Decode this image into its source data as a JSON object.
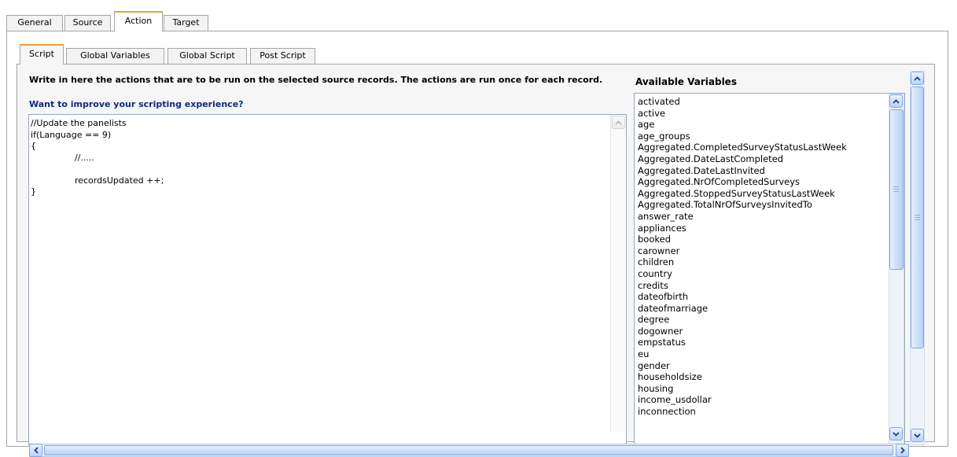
{
  "outer_tabs": [
    "General",
    "Source",
    "Action",
    "Target"
  ],
  "active_outer_tab": "Action",
  "inner_tabs": [
    "Script",
    "Global Variables",
    "Global Script",
    "Post Script"
  ],
  "active_inner_tab": "Script",
  "instructions": "Write in here the actions that are to be run on the selected source records. The actions are run once for each record.",
  "improve_link": "Want to improve your scripting experience?",
  "script_text": "//Update the panelists\nif(Language == 9)\n{\n\t\t//.....\n\n\t\trecordsUpdated ++;\n}",
  "available_variables_title": "Available Variables",
  "variables": [
    "activated",
    "active",
    "age",
    "age_groups",
    "Aggregated.CompletedSurveyStatusLastWeek",
    "Aggregated.DateLastCompleted",
    "Aggregated.DateLastInvited",
    "Aggregated.NrOfCompletedSurveys",
    "Aggregated.StoppedSurveyStatusLastWeek",
    "Aggregated.TotalNrOfSurveysInvitedTo",
    "answer_rate",
    "appliances",
    "booked",
    "carowner",
    "children",
    "country",
    "credits",
    "dateofbirth",
    "dateofmarriage",
    "degree",
    "dogowner",
    "empstatus",
    "eu",
    "gender",
    "householdsize",
    "housing",
    "income_usdollar",
    "inconnection"
  ],
  "icons": {
    "scroll_up": "chevron-up-icon",
    "scroll_down": "chevron-down-icon",
    "scroll_left": "chevron-left-icon",
    "scroll_right": "chevron-right-icon"
  },
  "colors": {
    "active_tab_accent": "#f0a030",
    "link": "#0b2a8a",
    "scroll_accent": "#7ea7e6"
  }
}
